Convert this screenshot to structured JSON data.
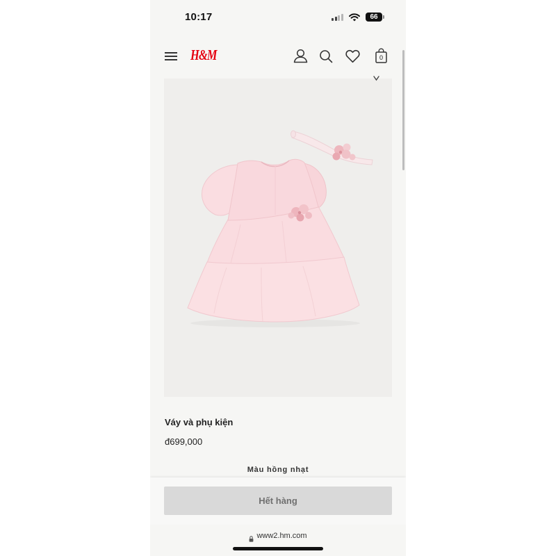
{
  "status_bar": {
    "time": "10:17",
    "battery": "66",
    "icons": [
      "signal-icon",
      "wifi-icon",
      "battery-icon"
    ]
  },
  "header": {
    "logo": "H&M",
    "bag_count": "0",
    "icons": {
      "menu": "hamburger-icon",
      "account": "user-icon",
      "search": "search-icon",
      "favorites": "heart-icon",
      "bag": "bag-icon"
    }
  },
  "product": {
    "name": "Váy và phụ kiện",
    "price": "đ699,000",
    "color": "Màu hồng nhạt",
    "image_background": "#efeeec"
  },
  "cta": {
    "label": "Hết hàng"
  },
  "browser": {
    "url": "www2.hm.com",
    "icon": "lock-icon"
  },
  "colors": {
    "brand": "#e50010",
    "button_bg": "#d9d9d9",
    "button_text": "#707070",
    "dress_pink": "#f9d8dd"
  }
}
